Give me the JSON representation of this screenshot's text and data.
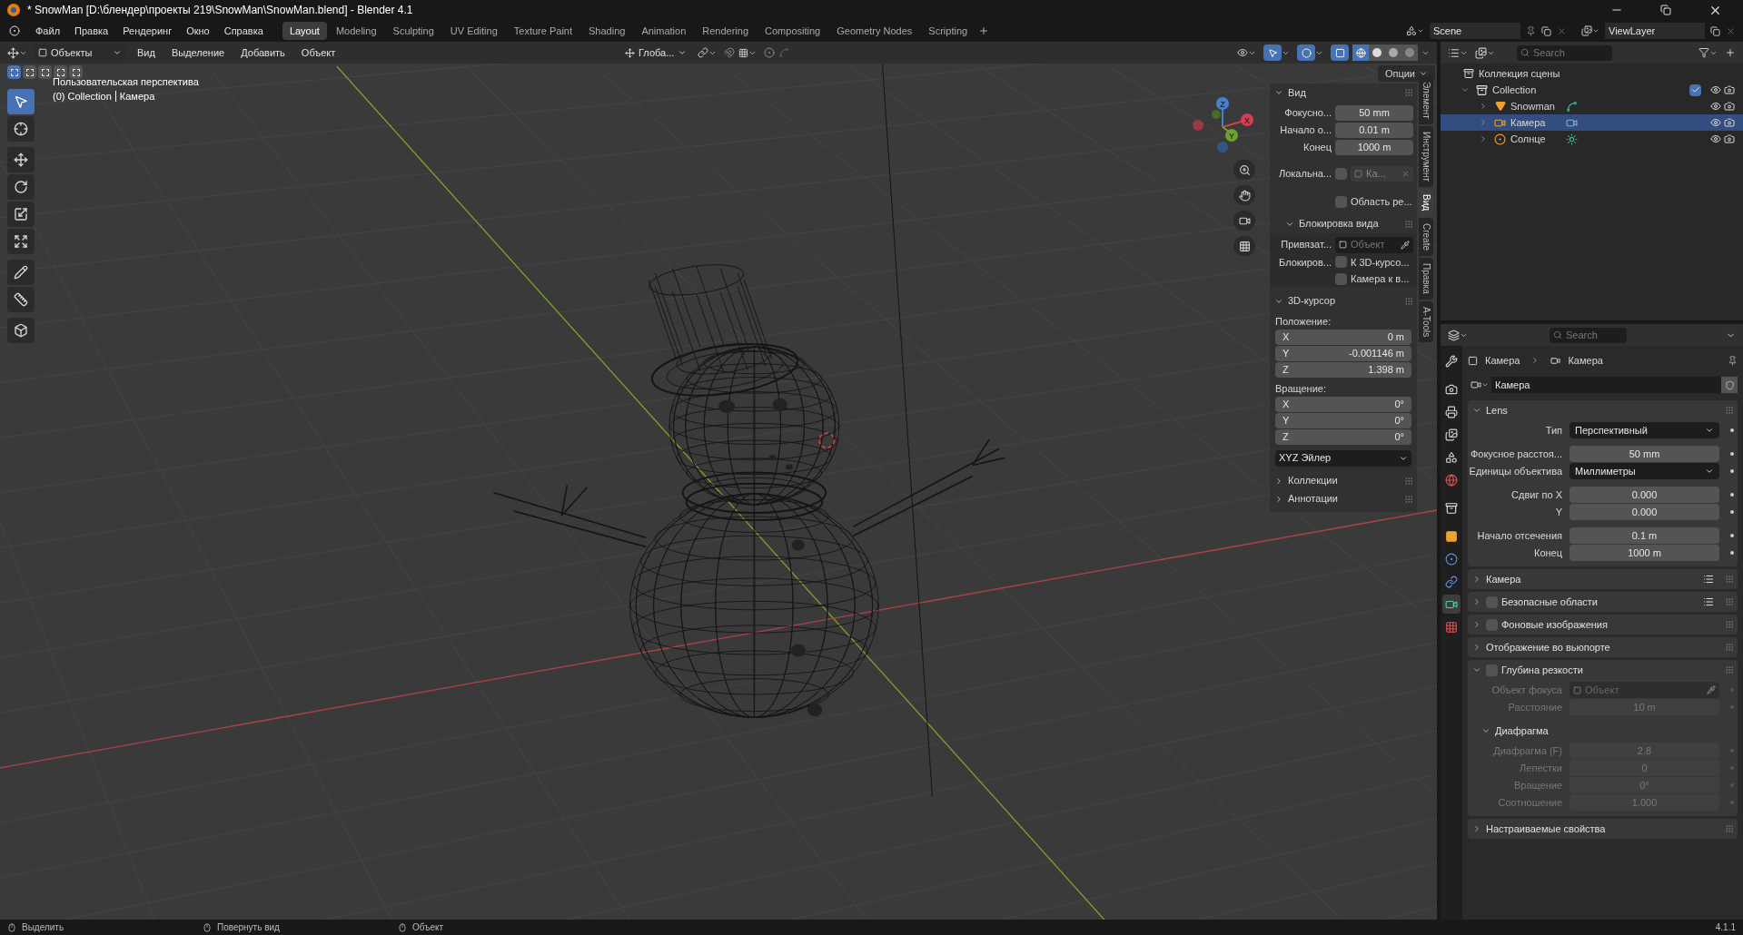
{
  "title_bar": {
    "title": "* SnowMan [D:\\блендер\\проекты 219\\SnowMan\\SnowMan.blend] - Blender 4.1"
  },
  "menu": [
    "Файл",
    "Правка",
    "Рендеринг",
    "Окно",
    "Справка"
  ],
  "workspaces": [
    {
      "label": "Layout",
      "selected": true
    },
    {
      "label": "Modeling",
      "selected": false
    },
    {
      "label": "Sculpting",
      "selected": false
    },
    {
      "label": "UV Editing",
      "selected": false
    },
    {
      "label": "Texture Paint",
      "selected": false
    },
    {
      "label": "Shading",
      "selected": false
    },
    {
      "label": "Animation",
      "selected": false
    },
    {
      "label": "Rendering",
      "selected": false
    },
    {
      "label": "Compositing",
      "selected": false
    },
    {
      "label": "Geometry Nodes",
      "selected": false
    },
    {
      "label": "Scripting",
      "selected": false
    }
  ],
  "scene": "Scene",
  "view_layer": "ViewLayer",
  "viewport": {
    "mode": "Объекты",
    "menu": [
      "Вид",
      "Выделение",
      "Добавить",
      "Объект"
    ],
    "orientation": "Глоба...",
    "options": "Опции",
    "shading": [
      {
        "kind": "wireframe",
        "selected": true
      },
      {
        "kind": "solid",
        "selected": false
      },
      {
        "kind": "material",
        "selected": false
      },
      {
        "kind": "rendered",
        "selected": false
      }
    ],
    "select_modes": [
      {
        "selected": true
      },
      {
        "selected": false
      },
      {
        "selected": false
      },
      {
        "selected": false
      },
      {
        "selected": false
      }
    ],
    "view_name": "Пользовательская перспектива",
    "collection": "(0) Collection",
    "object": "Камера",
    "tool_groups": [
      [
        {
          "kind": "select",
          "selected": true
        },
        {
          "kind": "cursor",
          "selected": false
        }
      ],
      [
        {
          "kind": "move",
          "selected": false
        },
        {
          "kind": "rotate",
          "selected": false
        },
        {
          "kind": "scale",
          "selected": false
        },
        {
          "kind": "transform",
          "selected": false
        }
      ],
      [
        {
          "kind": "annotate",
          "selected": false
        },
        {
          "kind": "measure",
          "selected": false
        }
      ],
      [
        {
          "kind": "add_cube",
          "selected": false
        }
      ]
    ],
    "gizmo": {
      "x": "X",
      "y": "Y",
      "z": "Z"
    }
  },
  "sidebar": {
    "tabs": [
      {
        "label": "Элемент",
        "selected": false
      },
      {
        "label": "Инструмент",
        "selected": false
      },
      {
        "label": "Вид",
        "selected": true
      },
      {
        "label": "Create",
        "selected": false
      },
      {
        "label": "Правка",
        "selected": false
      },
      {
        "label": "A-Tools",
        "selected": false
      }
    ],
    "view": {
      "title": "Вид",
      "expanded": true,
      "fields": [
        {
          "label": "Фокусно...",
          "value": "50 mm"
        },
        {
          "label": "Начало о...",
          "value": "0.01 m"
        },
        {
          "label": "Конец",
          "value": "1000 m"
        }
      ],
      "local_label": "Локальна...",
      "local_checked": false,
      "local_value": "Ка...",
      "region_label": "Область ре...",
      "region_checked": false
    },
    "lock": {
      "title": "Блокировка вида",
      "expanded": true,
      "anchor_label": "Привязат...",
      "anchor_placeholder": "Объект",
      "lock_label": "Блокиров...",
      "options": [
        {
          "label": "К 3D-курсо...",
          "checked": false
        },
        {
          "label": "Камера к в...",
          "checked": false
        }
      ]
    },
    "cursor": {
      "title": "3D-курсор",
      "expanded": true,
      "location_label": "Положение:",
      "location": [
        {
          "axis": "X",
          "value": "0 m"
        },
        {
          "axis": "Y",
          "value": "-0.001146 m"
        },
        {
          "axis": "Z",
          "value": "1.398 m"
        }
      ],
      "rotation_label": "Вращение:",
      "rotation": [
        {
          "axis": "X",
          "value": "0°"
        },
        {
          "axis": "Y",
          "value": "0°"
        },
        {
          "axis": "Z",
          "value": "0°"
        }
      ],
      "rotation_mode": "XYZ Эйлер"
    },
    "more": [
      {
        "title": "Коллекции",
        "expanded": false
      },
      {
        "title": "Аннотации",
        "expanded": false
      }
    ]
  },
  "outliner": {
    "search_placeholder": "Search",
    "root": "Коллекция сцены",
    "tree": [
      {
        "name": "Collection",
        "kind": "collection",
        "expanded": true,
        "checked": true,
        "selected": false,
        "children": [
          {
            "name": "Snowman",
            "kind": "mesh",
            "expanded": false,
            "selected": false
          },
          {
            "name": "Камера",
            "kind": "camera",
            "expanded": false,
            "selected": true
          },
          {
            "name": "Солнце",
            "kind": "light",
            "expanded": false,
            "selected": false
          }
        ]
      }
    ]
  },
  "properties": {
    "search_placeholder": "Search",
    "tabs": [
      {
        "kind": "tool",
        "selected": false
      },
      {
        "kind": "render",
        "selected": false
      },
      {
        "kind": "output",
        "selected": false
      },
      {
        "kind": "view_layer",
        "selected": false
      },
      {
        "kind": "scene",
        "selected": false
      },
      {
        "kind": "world",
        "selected": false
      },
      {
        "kind": "collection",
        "selected": false
      },
      {
        "kind": "object",
        "selected": false
      },
      {
        "kind": "physics",
        "selected": false
      },
      {
        "kind": "constraints",
        "selected": false
      },
      {
        "kind": "data",
        "selected": true
      },
      {
        "kind": "texture",
        "selected": false
      }
    ],
    "breadcrumb": [
      "Камера",
      "Камера"
    ],
    "datablock": "Камера",
    "panels": [
      {
        "title": "Lens",
        "expanded": true,
        "disabled": false,
        "groups": [
          [
            {
              "kind": "dropdown",
              "label": "Тип",
              "value": "Перспективный"
            }
          ],
          [
            {
              "kind": "number",
              "label": "Фокусное расстоя...",
              "value": "50 mm"
            },
            {
              "kind": "dropdown",
              "label": "Единицы объектива",
              "value": "Миллиметры"
            }
          ],
          [
            {
              "kind": "number",
              "label": "Сдвиг по X",
              "value": "0.000"
            },
            {
              "kind": "number",
              "label": "Y",
              "value": "0.000"
            }
          ],
          [
            {
              "kind": "number",
              "label": "Начало отсечения",
              "value": "0.1 m"
            },
            {
              "kind": "number",
              "label": "Конец",
              "value": "1000 m"
            }
          ]
        ]
      },
      {
        "title": "Камера",
        "expanded": false,
        "presets": true
      },
      {
        "title": "Безопасные области",
        "expanded": false,
        "checkbox": false,
        "presets": true
      },
      {
        "title": "Фоновые изображения",
        "expanded": false,
        "checkbox": false
      },
      {
        "title": "Отображение во вьюпорте",
        "expanded": false
      },
      {
        "title": "Глубина резкости",
        "expanded": true,
        "checkbox": false,
        "disabled": true,
        "groups": [
          [
            {
              "kind": "object",
              "label": "Объект фокуса",
              "placeholder": "Объект"
            },
            {
              "kind": "number",
              "label": "Расстояние",
              "value": "10 m"
            }
          ]
        ],
        "subpanels": [
          {
            "title": "Диафрагма",
            "expanded": true,
            "groups": [
              [
                {
                  "kind": "number",
                  "label": "Диафрагма (F)",
                  "value": "2.8"
                },
                {
                  "kind": "number",
                  "label": "Лепестки",
                  "value": "0"
                },
                {
                  "kind": "number",
                  "label": "Вращение",
                  "value": "0°"
                },
                {
                  "kind": "number",
                  "label": "Соотношение",
                  "value": "1.000"
                }
              ]
            ]
          }
        ]
      },
      {
        "title": "Настраиваемые свойства",
        "expanded": false
      }
    ]
  },
  "status_bar": {
    "hints": [
      "Выделить",
      "Повернуть вид",
      "Объект"
    ],
    "version": "4.1.1"
  }
}
